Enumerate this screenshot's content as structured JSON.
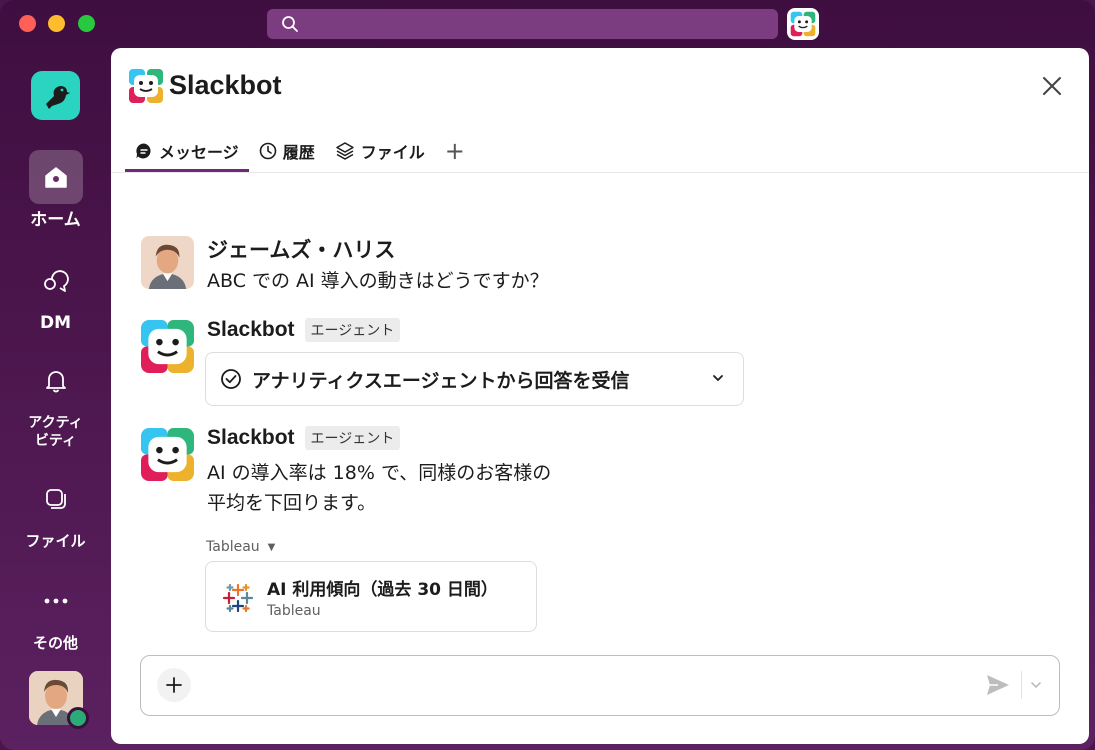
{
  "sidebar": {
    "items": [
      {
        "label": "ホーム"
      },
      {
        "label": "DM"
      },
      {
        "label": "アクティ\nビティ",
        "line1": "アクティ",
        "line2": "ビティ"
      },
      {
        "label": "ファイル"
      },
      {
        "label": "その他"
      }
    ]
  },
  "panel": {
    "title": "Slackbot",
    "tabs": [
      {
        "label": "メッセージ"
      },
      {
        "label": "履歴"
      },
      {
        "label": "ファイル"
      }
    ],
    "add_tab": "+"
  },
  "messages": [
    {
      "sender": "ジェームズ・ハリス",
      "text": "ABC での AI 導入の動きはどうですか？"
    },
    {
      "sender": "Slackbot",
      "badge": "エージェント",
      "card": "アナリティクスエージェントから回答を受信"
    },
    {
      "sender": "Slackbot",
      "badge": "エージェント",
      "text_line1": "AI の導入率は 18% で、同様のお客様の",
      "text_line2": "平均を下回ります。",
      "source_label": "Tableau",
      "attachment": {
        "title": "AI 利用傾向（過去 30 日間）",
        "subtitle": "Tableau"
      }
    }
  ],
  "colors": {
    "sidebar_bg": "#4a154b",
    "search_bg": "#7b3c80",
    "active_tab": "#6e2a76",
    "presence": "#2bac76",
    "app_logo": "#2bd4c0"
  }
}
